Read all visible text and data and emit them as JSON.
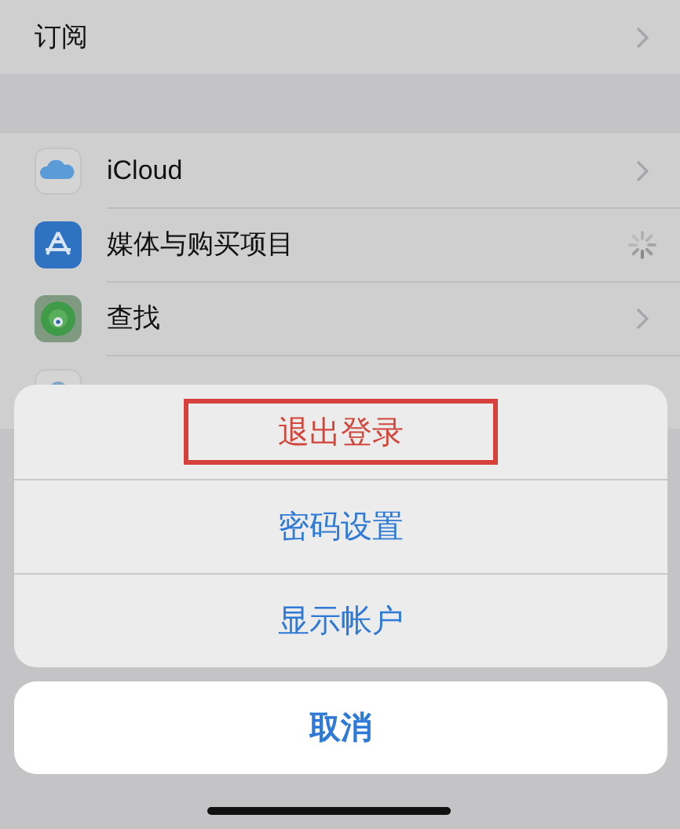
{
  "top_rows": [
    {
      "label": "订阅"
    }
  ],
  "account_rows": [
    {
      "label": "iCloud",
      "kind": "link"
    },
    {
      "label": "媒体与购买项目",
      "kind": "loading"
    },
    {
      "label": "查找",
      "kind": "link"
    },
    {
      "kind": "covered"
    }
  ],
  "action_sheet": {
    "actions": [
      {
        "label": "退出登录",
        "kind": "destructive",
        "highlighted": true
      },
      {
        "label": "密码设置",
        "kind": "default",
        "highlighted": false
      },
      {
        "label": "显示帐户",
        "kind": "default",
        "highlighted": false
      }
    ],
    "cancel": {
      "label": "取消"
    }
  }
}
